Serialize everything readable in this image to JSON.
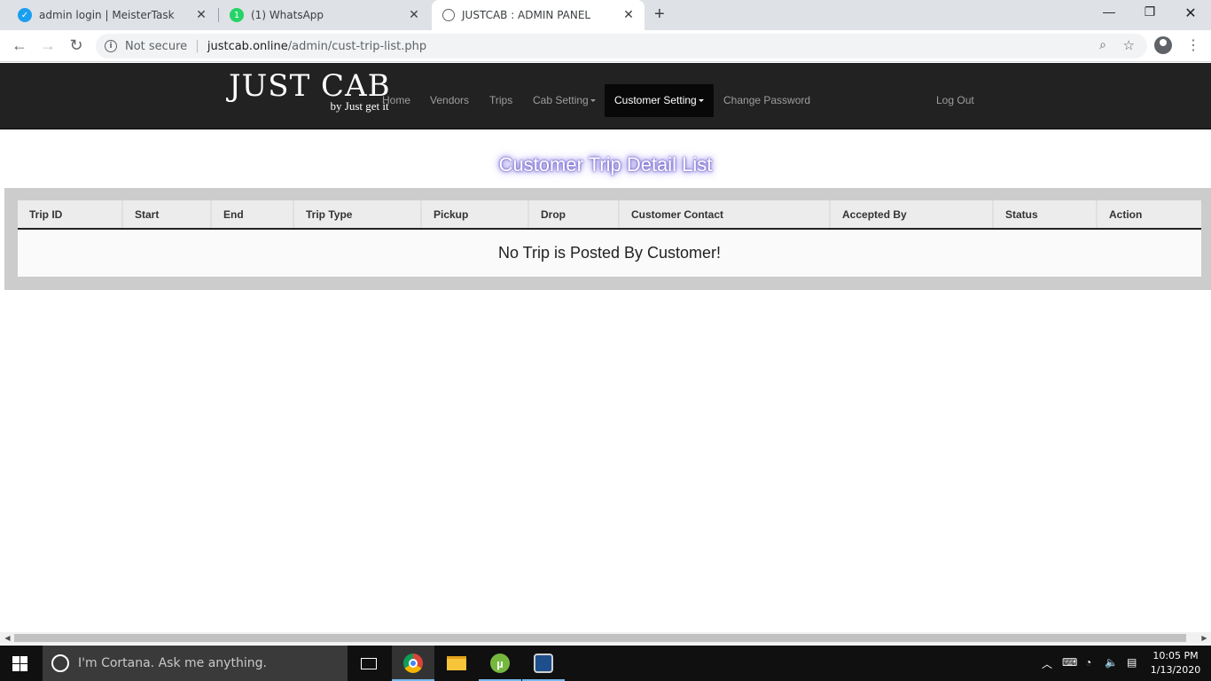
{
  "browser": {
    "tabs": [
      {
        "title": "admin login | MeisterTask",
        "icon": "meistertask-icon"
      },
      {
        "title": "(1) WhatsApp",
        "icon": "whatsapp-icon"
      },
      {
        "title": "JUSTCAB : ADMIN PANEL",
        "icon": "globe-icon",
        "active": true
      }
    ],
    "security_label": "Not secure",
    "url_host": "justcab.online",
    "url_path": "/admin/cust-trip-list.php"
  },
  "navbar": {
    "brand_main": "JUST CAB",
    "brand_tagline": "by Just get it",
    "items": [
      {
        "label": "Home"
      },
      {
        "label": "Vendors"
      },
      {
        "label": "Trips"
      },
      {
        "label": "Cab Setting"
      },
      {
        "label": "Customer Setting",
        "active": true
      },
      {
        "label": "Change Password"
      },
      {
        "label": "Log Out"
      }
    ]
  },
  "page": {
    "title": "Customer Trip Detail List",
    "table": {
      "columns": [
        "Trip ID",
        "Start",
        "End",
        "Trip Type",
        "Pickup",
        "Drop",
        "Customer Contact",
        "Accepted By",
        "Status",
        "Action"
      ],
      "empty_message": "No Trip is Posted By Customer!"
    }
  },
  "taskbar": {
    "search_placeholder": "I'm Cortana. Ask me anything.",
    "time": "10:05 PM",
    "date": "1/13/2020",
    "apps": [
      "task-view-icon",
      "chrome-icon",
      "file-explorer-icon",
      "utorrent-icon",
      "media-player-icon"
    ]
  },
  "colors": {
    "navbar_bg": "#222222",
    "nav_active_bg": "#080808",
    "table_frame": "#cccccc",
    "title_glow": "#7b68ee"
  }
}
